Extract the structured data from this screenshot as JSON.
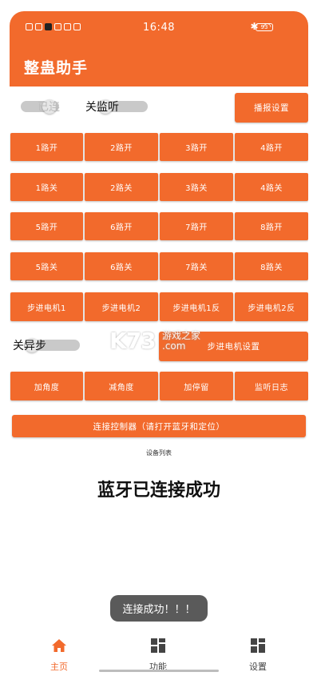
{
  "status_bar": {
    "time": "16:48",
    "battery": "93"
  },
  "app": {
    "title": "整蛊助手"
  },
  "controls": {
    "connection_toggle": "已连",
    "monitor_toggle": "关监听",
    "broadcast_settings": "播报设置",
    "async_toggle": "关异步",
    "stepper_settings": "步进电机设置",
    "connect_controller": "连接控制器（请打开蓝牙和定位）"
  },
  "grid": {
    "row1": [
      "1路开",
      "2路开",
      "3路开",
      "4路开"
    ],
    "row2": [
      "1路关",
      "2路关",
      "3路关",
      "4路关"
    ],
    "row3": [
      "5路开",
      "6路开",
      "7路开",
      "8路开"
    ],
    "row4": [
      "5路关",
      "6路关",
      "7路关",
      "8路关"
    ],
    "row5": [
      "步进电机1",
      "步进电机2",
      "步进电机1反",
      "步进电机2反"
    ],
    "row7": [
      "加角度",
      "减角度",
      "加停留",
      "监听日志"
    ]
  },
  "device_list_label": "设备列表",
  "connection_status": "蓝牙已连接成功",
  "toast": "连接成功！！！",
  "watermark": {
    "logo": "K73",
    "text1": "游戏之家",
    "text2": ".com"
  },
  "tabs": [
    {
      "label": "主页",
      "icon": "home-icon"
    },
    {
      "label": "功能",
      "icon": "grid-icon"
    },
    {
      "label": "设置",
      "icon": "grid-icon"
    }
  ],
  "colors": {
    "accent": "#f26a2c",
    "toast_bg": "#5a5a5a"
  }
}
